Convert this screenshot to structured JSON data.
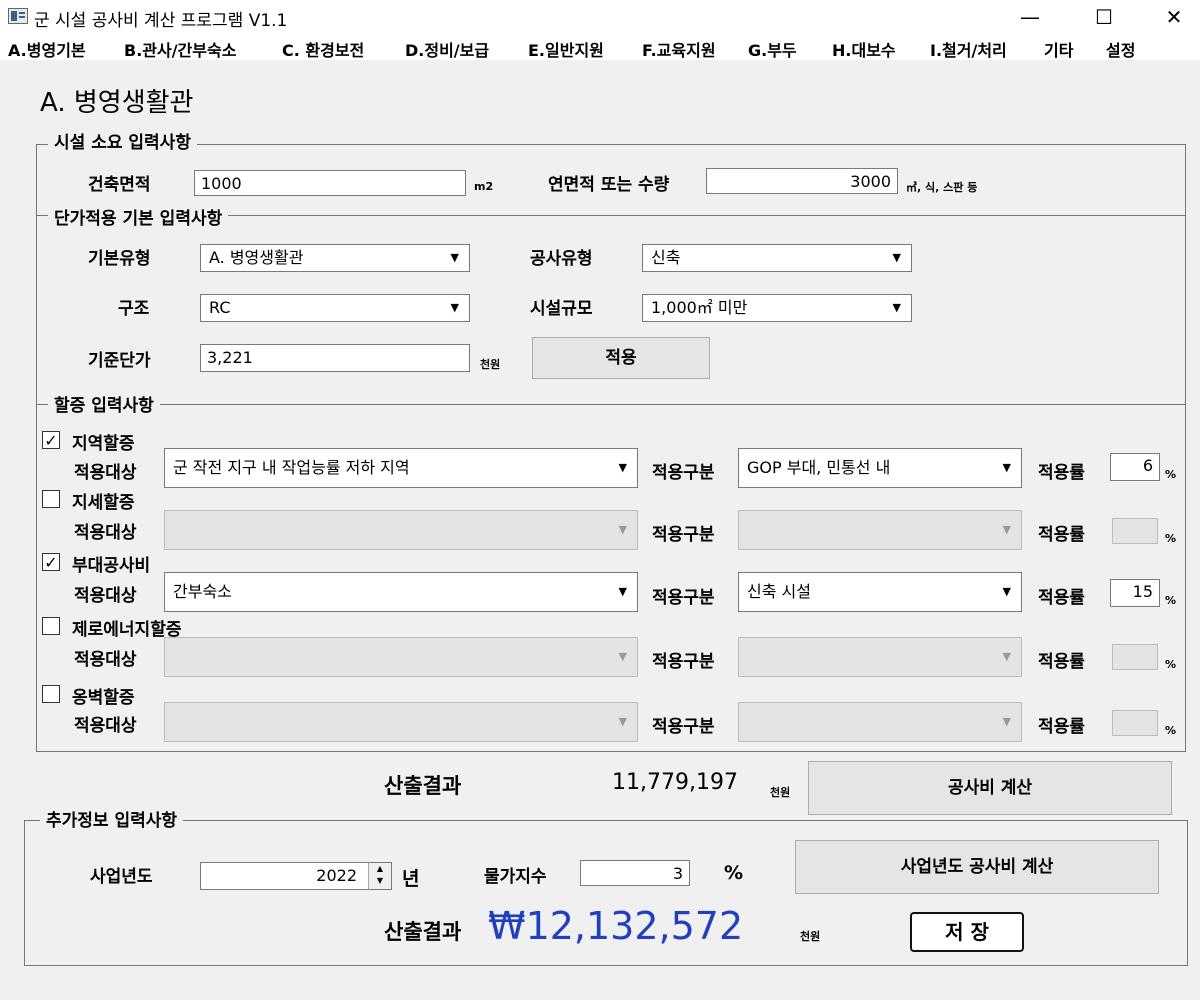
{
  "window": {
    "title": "군 시설 공사비 계산 프로그램 V1.1",
    "minimize": "—",
    "maximize": "☐",
    "close": "✕"
  },
  "menu": [
    "A.병영기본",
    "B.관사/간부숙소",
    "C. 환경보전",
    "D.정비/보급",
    "E.일반지원",
    "F.교육지원",
    "G.부두",
    "H.대보수",
    "I.철거/처리",
    "기타",
    "설정"
  ],
  "page_title": "A. 병영생활관",
  "facility": {
    "group_title": "시설 소요 입력사항",
    "building_area_label": "건축면적",
    "building_area_value": "1000",
    "building_area_unit": "m2",
    "total_area_label": "연면적 또는 수량",
    "total_area_value": "3000",
    "total_area_unit": "㎥, 식, 스판 등"
  },
  "unit_price": {
    "group_title": "단가적용 기본 입력사항",
    "basic_type_label": "기본유형",
    "basic_type_value": "A. 병영생활관",
    "construction_type_label": "공사유형",
    "construction_type_value": "신축",
    "structure_label": "구조",
    "structure_value": "RC",
    "facility_scale_label": "시설규모",
    "facility_scale_value": "1,000㎡ 미만",
    "base_price_label": "기준단가",
    "base_price_value": "3,221",
    "base_price_unit": "천원",
    "apply_button": "적용"
  },
  "surcharge": {
    "group_title": "할증 입력사항",
    "target_label": "적용대상",
    "category_label": "적용구분",
    "rate_label": "적용률",
    "rate_unit": "%",
    "items": [
      {
        "name": "지역할증",
        "checked": "✓",
        "target": "군 작전 지구 내 작업능률 저하 지역",
        "category": "GOP 부대, 민통선 내",
        "rate": "6"
      },
      {
        "name": "지세할증",
        "checked": "",
        "target": "",
        "category": "",
        "rate": ""
      },
      {
        "name": "부대공사비",
        "checked": "✓",
        "target": "간부숙소",
        "category": "신축 시설",
        "rate": "15"
      },
      {
        "name": "제로에너지할증",
        "checked": "",
        "target": "",
        "category": "",
        "rate": ""
      },
      {
        "name": "옹벽할증",
        "checked": "",
        "target": "",
        "category": "",
        "rate": ""
      }
    ]
  },
  "result": {
    "label": "산출결과",
    "value": "11,779,197",
    "unit": "천원",
    "calc_button": "공사비 계산"
  },
  "additional": {
    "group_title": "추가정보 입력사항",
    "year_label": "사업년도",
    "year_value": "2022",
    "year_unit": "년",
    "price_index_label": "물가지수",
    "price_index_value": "3",
    "price_index_unit": "%",
    "year_calc_button": "사업년도 공사비 계산",
    "result_label": "산출결과",
    "result_value": "₩12,132,572",
    "result_unit": "천원",
    "save_button": "저 장"
  },
  "colors": {
    "final_result": "#1f3fbf"
  }
}
